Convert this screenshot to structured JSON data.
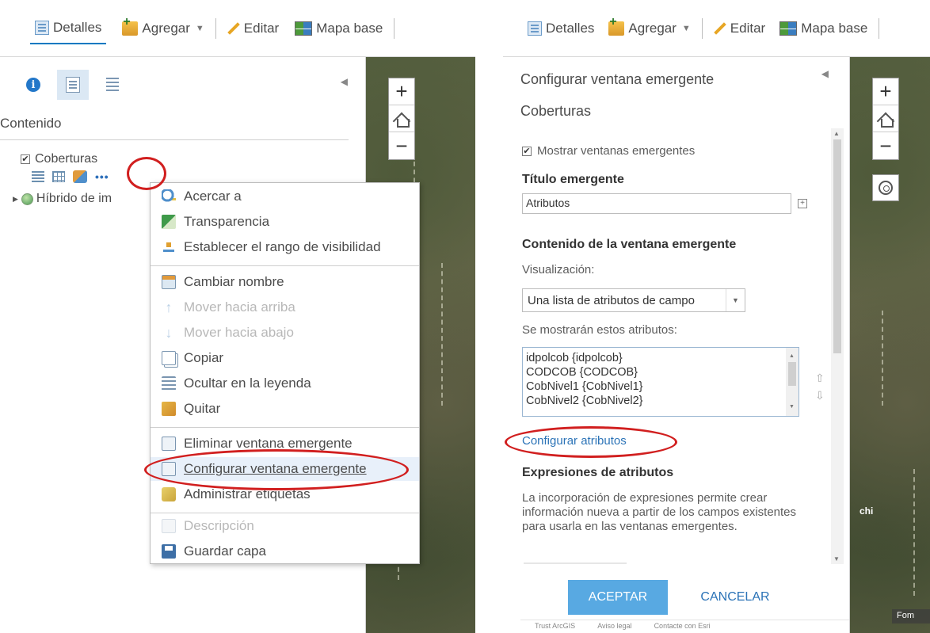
{
  "toolbar": {
    "details": "Detalles",
    "add": "Agregar",
    "edit": "Editar",
    "basemap": "Mapa base"
  },
  "left": {
    "section_title": "Contenido",
    "layer_name": "Coberturas",
    "layer2_name": "Híbrido de im",
    "menu": [
      {
        "label": "Acercar a",
        "enabled": true
      },
      {
        "label": "Transparencia",
        "enabled": true
      },
      {
        "label": "Establecer el rango de visibilidad",
        "enabled": true
      },
      {
        "label": "Cambiar nombre",
        "enabled": true
      },
      {
        "label": "Mover hacia arriba",
        "enabled": false
      },
      {
        "label": "Mover hacia abajo",
        "enabled": false
      },
      {
        "label": "Copiar",
        "enabled": true
      },
      {
        "label": "Ocultar en la leyenda",
        "enabled": true
      },
      {
        "label": "Quitar",
        "enabled": true
      },
      {
        "label": "Eliminar ventana emergente",
        "enabled": true
      },
      {
        "label": "Configurar ventana emergente",
        "enabled": true
      },
      {
        "label": "Administrar etiquetas",
        "enabled": true
      },
      {
        "label": "Descripción",
        "enabled": false
      },
      {
        "label": "Guardar capa",
        "enabled": true
      }
    ]
  },
  "right": {
    "title": "Configurar ventana emergente",
    "subtitle": "Coberturas",
    "show_popups": "Mostrar ventanas emergentes",
    "popup_title_label": "Título emergente",
    "popup_title_value": "Atributos",
    "content_heading": "Contenido de la ventana emergente",
    "display_label": "Visualización:",
    "display_value": "Una lista de atributos de campo",
    "attrs_label": "Se mostrarán estos atributos:",
    "attributes": [
      "idpolcob {idpolcob}",
      "CODCOB {CODCOB}",
      "CobNivel1 {CobNivel1}",
      "CobNivel2 {CobNivel2}"
    ],
    "configure_attrs": "Configurar atributos",
    "expr_heading": "Expresiones de atributos",
    "expr_text": "La incorporación de expresiones permite crear información nueva a partir de los campos existentes para usarla en las ventanas emergentes.",
    "ok": "ACEPTAR",
    "cancel": "CANCELAR",
    "footer": [
      "Trust ArcGIS",
      "Aviso legal",
      "Contacte con Esri"
    ],
    "map_label": "chi",
    "map_label2": "Fom"
  },
  "colors": {
    "accent": "#0079c1",
    "highlight_oval": "#d11f1f",
    "primary_button": "#58a9e2"
  }
}
